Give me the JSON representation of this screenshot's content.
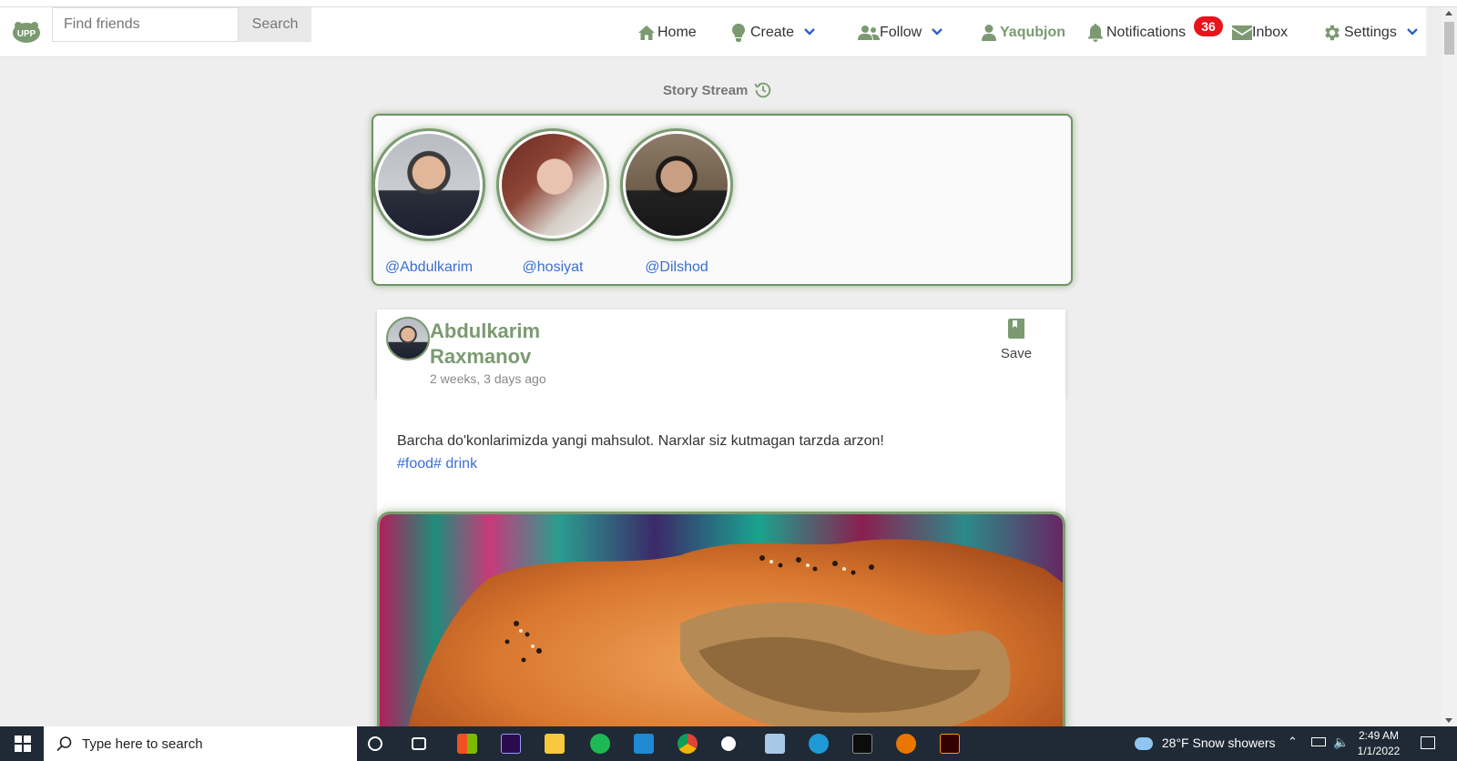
{
  "navbar": {
    "search_placeholder": "Find friends",
    "search_button": "Search",
    "home": "Home",
    "create": "Create",
    "follow": "Follow",
    "user": "Yaqubjon",
    "notifications": "Notifications",
    "notifications_count": "36",
    "inbox": "Inbox",
    "settings": "Settings"
  },
  "story": {
    "title": "Story Stream",
    "items": [
      {
        "handle": "@Abdulkarim"
      },
      {
        "handle": "@hosiyat"
      },
      {
        "handle": "@Dilshod"
      }
    ]
  },
  "post": {
    "author": "Abdulkarim Raxmanov",
    "time": "2 weeks, 3 days ago",
    "save_label": "Save",
    "text": "Barcha do'konlarimizda yangi mahsulot. Narxlar siz kutmagan tarzda arzon!",
    "tags": "#food# drink"
  },
  "taskbar": {
    "search_placeholder": "Type here to search",
    "weather": "28°F  Snow showers",
    "time": "2:49 AM",
    "date": "1/1/2022"
  },
  "colors": {
    "accent": "#7b9a71",
    "link": "#3a6fcf",
    "badge": "#e8141c"
  }
}
